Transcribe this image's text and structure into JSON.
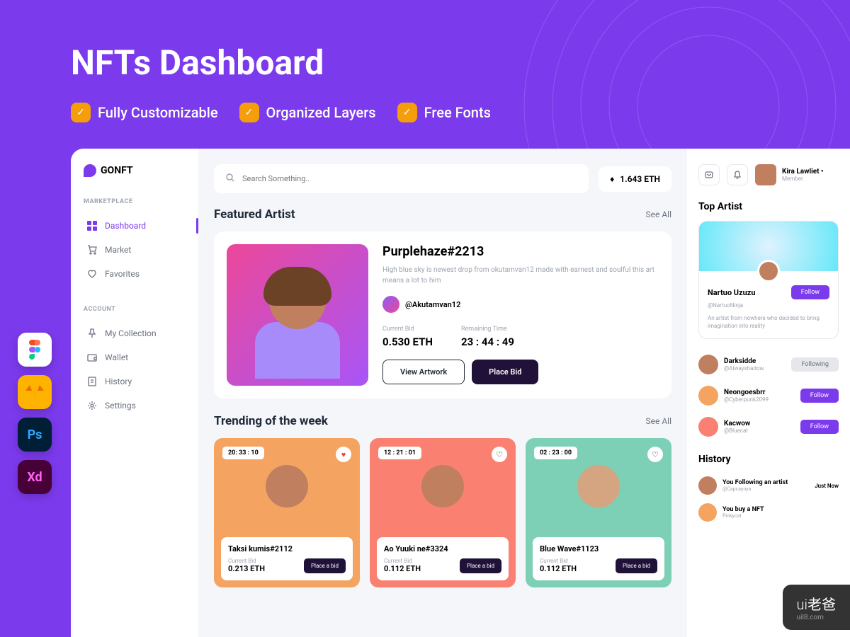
{
  "promo": {
    "title": "NFTs Dashboard",
    "features": [
      "Fully Customizable",
      "Organized Layers",
      "Free Fonts"
    ]
  },
  "brand": "GONFT",
  "sidebar": {
    "marketplace_label": "MARKETPLACE",
    "marketplace": [
      {
        "label": "Dashboard",
        "active": true
      },
      {
        "label": "Market"
      },
      {
        "label": "Favorites"
      }
    ],
    "account_label": "ACCOUNT",
    "account": [
      {
        "label": "My Collection"
      },
      {
        "label": "Wallet"
      },
      {
        "label": "History"
      },
      {
        "label": "Settings"
      }
    ]
  },
  "search": {
    "placeholder": "Search Something.."
  },
  "balance": "1.643 ETH",
  "featured": {
    "section_title": "Featured Artist",
    "see_all": "See All",
    "title": "Purplehaze#2213",
    "desc": "High blue sky is newest drop from okutamvan12 made with earnest and soulful this art means a lot to him",
    "artist": "@Akutamvan12",
    "bid_label": "Current Bid",
    "bid_value": "0.530 ETH",
    "time_label": "Remaining Time",
    "time_value": "23 : 44 : 49",
    "view_btn": "View Artwork",
    "bid_btn": "Place Bid"
  },
  "trending": {
    "section_title": "Trending of the week",
    "see_all": "See All",
    "items": [
      {
        "timer": "20: 33 : 10",
        "liked": true,
        "name": "Taksi kumis#2112",
        "bid_label": "Current Bid",
        "bid": "0.213 ETH",
        "btn": "Place a bid"
      },
      {
        "timer": "12 : 21 : 01",
        "liked": false,
        "name": "Ao Yuuki ne#3324",
        "bid_label": "Current Bid",
        "bid": "0.112 ETH",
        "btn": "Place a bid"
      },
      {
        "timer": "02 : 23 : 00",
        "liked": false,
        "name": "Blue Wave#1123",
        "bid_label": "Current Bid",
        "bid": "0.112 ETH",
        "btn": "Place a bid"
      }
    ]
  },
  "user": {
    "name": "Kira Lawliet",
    "role": "Member"
  },
  "top_artist": {
    "title": "Top Artist",
    "name": "Nartuo Uzuzu",
    "handle": "@NartuoNinja",
    "desc": "An artist from nowhere who decided to bring imagination into reality",
    "follow": "Follow",
    "list": [
      {
        "name": "Darksidde",
        "handle": "@Alwayshadow",
        "status": "Following",
        "following": true
      },
      {
        "name": "Neongoesbrr",
        "handle": "@Cyberpunk2099",
        "status": "Follow",
        "following": false
      },
      {
        "name": "Kacwow",
        "handle": "@Bluecat",
        "status": "Follow",
        "following": false
      }
    ]
  },
  "history": {
    "title": "History",
    "items": [
      {
        "text": "You Following an artist",
        "sub": "@Capcaynya",
        "time": "Just Now"
      },
      {
        "text": "You buy a NFT",
        "sub": "Pinkycat",
        "time": ""
      }
    ]
  },
  "watermark": {
    "brand": "ui老爸",
    "url": "uil8.com"
  }
}
